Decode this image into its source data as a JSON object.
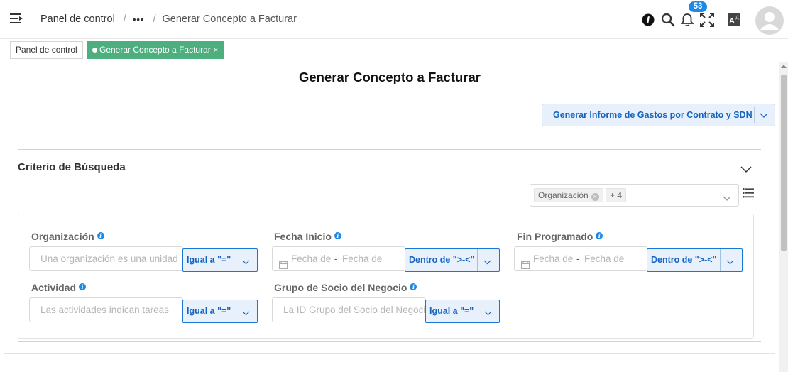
{
  "header": {
    "breadcrumb_home": "Panel de control",
    "breadcrumb_sep": "/",
    "breadcrumb_more": "•••",
    "breadcrumb_current": "Generar Concepto a Facturar",
    "notification_count": "53",
    "icons": [
      "menu-icon",
      "info-icon",
      "search-icon",
      "bell-icon",
      "fullscreen-icon",
      "translate-icon",
      "avatar"
    ]
  },
  "tabs": [
    {
      "label": "Panel de control",
      "active": false
    },
    {
      "label": "Generar Concepto a Facturar",
      "close": "×",
      "active": true
    }
  ],
  "page": {
    "title": "Generar Concepto a Facturar",
    "report_button": "Generar Informe de Gastos por Contrato y SDN"
  },
  "search": {
    "title": "Criterio de Búsqueda",
    "selected_filter": "Organización",
    "more_filters": "+ 4",
    "fields": {
      "org": {
        "label": "Organización",
        "placeholder": "Una organización es una unidad",
        "operator": "Igual a \"=\""
      },
      "start": {
        "label": "Fecha Inicio",
        "from": "Fecha desde",
        "to": "Fecha desde",
        "dash": "-",
        "operator": "Dentro de \">-<\""
      },
      "end": {
        "label": "Fin Programado",
        "from": "Fecha desde",
        "to": "Fecha desde",
        "dash": "-",
        "operator": "Dentro de \">-<\""
      },
      "activity": {
        "label": "Actividad",
        "placeholder": "Las actividades indican tareas",
        "operator": "Igual a \"=\""
      },
      "bp_group": {
        "label": "Grupo de Socio del Negocio",
        "placeholder": "La ID Grupo del Socio del Negocio",
        "operator": "Igual a \"=\""
      }
    }
  },
  "colors": {
    "accent": "#1e88e5",
    "tab_active": "#4caf7d",
    "button_border": "#1976d2",
    "button_fill": "#e8f1fb"
  }
}
